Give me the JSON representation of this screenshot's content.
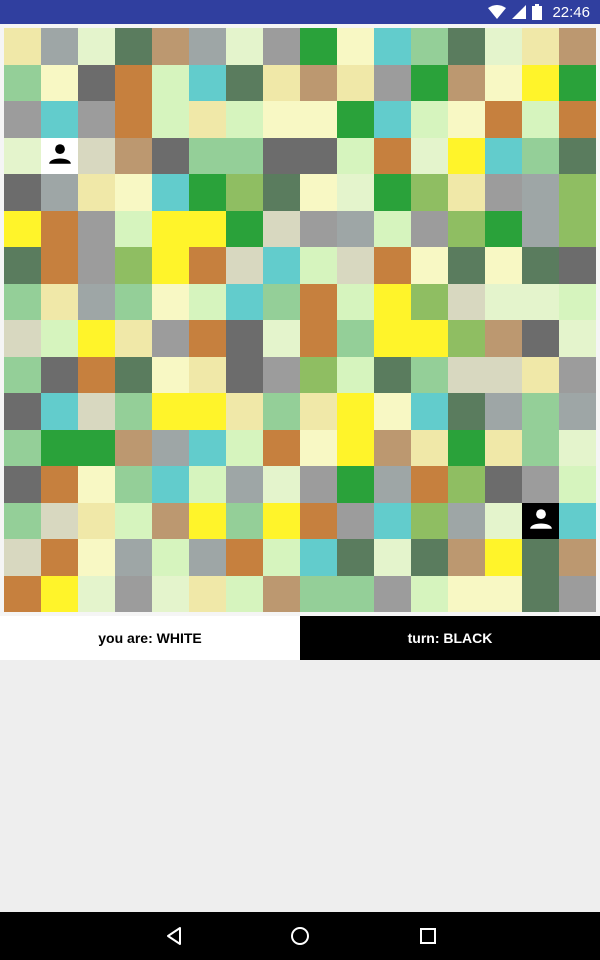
{
  "status_bar": {
    "time": "22:46",
    "icons": [
      "wifi-icon",
      "signal-icon",
      "battery-icon"
    ],
    "background": "#303f9f"
  },
  "board": {
    "columns": 16,
    "rows": 16,
    "palette": {
      "A": "#f0e8a8",
      "B": "#9ea6a6",
      "C": "#e4f4cc",
      "D": "#5a7c5e",
      "E": "#bc9870",
      "F": "#2aa23a",
      "G": "#f8f8c4",
      "H": "#62cccc",
      "I": "#94cf98",
      "J": "#6c6c6c",
      "K": "#c6803e",
      "L": "#d8d8c0",
      "M": "#d6f4be",
      "N": "#8fbe62",
      "O": "#fff42a",
      "P": "#9c9c9c",
      "Q": "#ffffff",
      "R": "#000000"
    },
    "rows_data": [
      "ABCDEBCPFGHIDCAE",
      "IGJKMHDAEAPFEGOF",
      "PHPKMAMGGFHMGKMK",
      "CQLEJIIJJMKCOHID",
      "JBAGHFNDGCFNAPBN",
      "OKPMOOFLPBMPNFBN",
      "DKPNOKLHMLKGDGDJ",
      "IABIGMHIKMONLCCM",
      "LMOAPKJCKIOONEJC",
      "IJKDGAJPNMDILLAP",
      "JHLIOOAIAOGHDBIB",
      "IFFEBHMKGOEAFAIC",
      "JKGIHMBCPFBKNJPM",
      "ILAMEOIOKPHNBCRH",
      "LKGBMBKMHDCDEODE",
      "KOCPCAMEIIPMGGDP"
    ],
    "white_pawn": {
      "row": 3,
      "col": 1,
      "piece": "person-icon",
      "color": "WHITE"
    },
    "black_pawn": {
      "row": 13,
      "col": 14,
      "piece": "person-icon",
      "color": "BLACK"
    }
  },
  "info": {
    "you_are": "you are: WHITE",
    "turn": "turn: BLACK"
  },
  "nav_bar": {
    "buttons": [
      "back-icon",
      "home-icon",
      "recents-icon"
    ]
  }
}
